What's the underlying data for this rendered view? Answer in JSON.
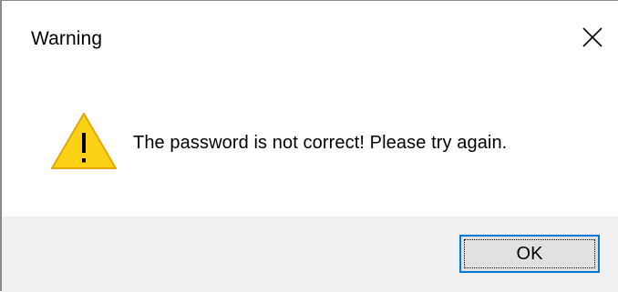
{
  "dialog": {
    "title": "Warning",
    "icon": "warning-triangle-icon",
    "message": "The password is not correct! Please try again.",
    "ok_label": "OK",
    "close_icon": "close-icon"
  },
  "colors": {
    "footer_background": "#f0f0f0",
    "warning_fill": "#fcd116",
    "focus_border": "#0078d7"
  }
}
